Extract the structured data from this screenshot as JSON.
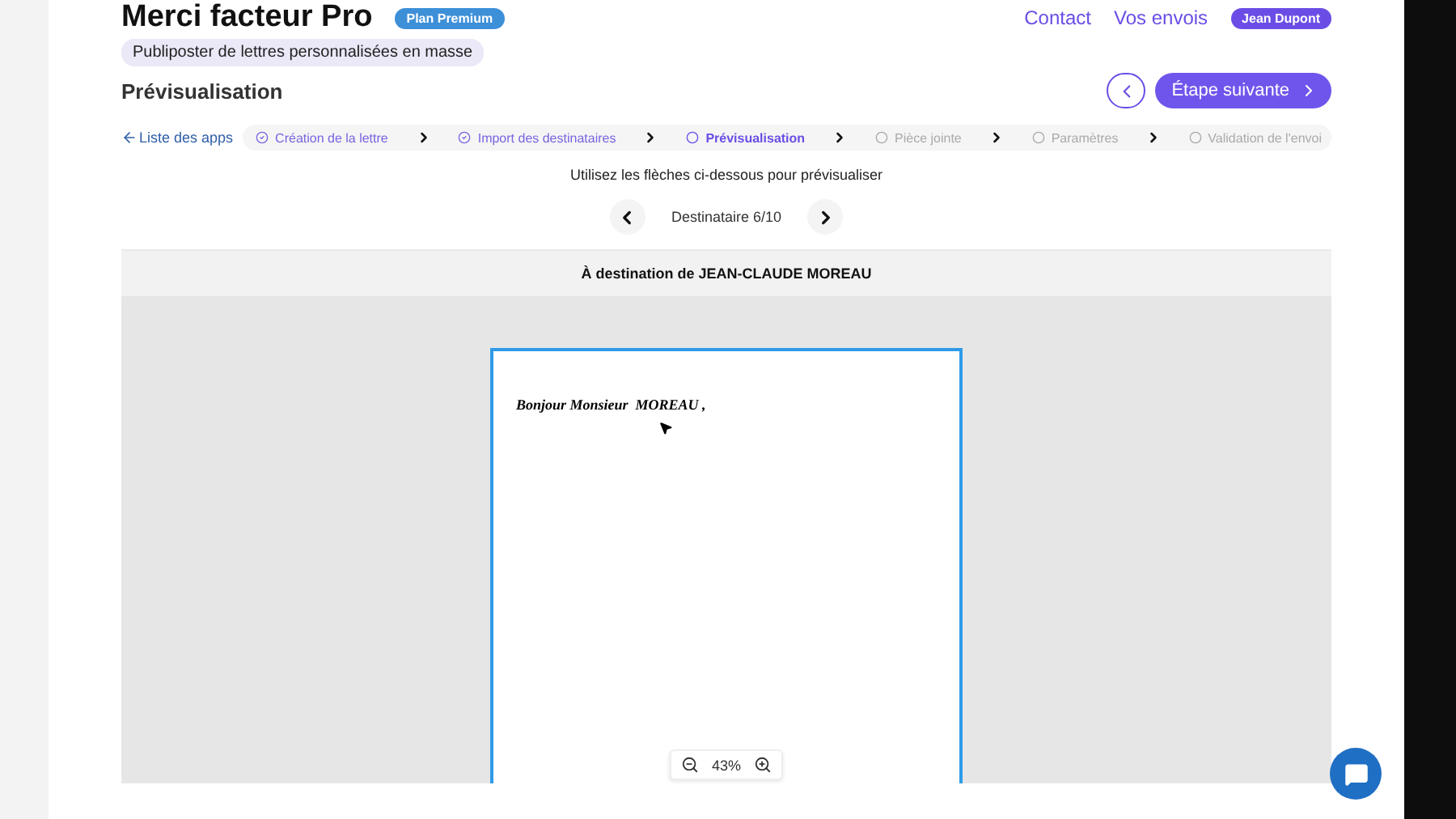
{
  "header": {
    "brand": "Merci facteur Pro",
    "plan_badge": "Plan Premium",
    "nav": [
      "Contact",
      "Vos envois"
    ],
    "user_badge": "Jean Dupont"
  },
  "app_tag": "Publiposter de lettres personnalisées en masse",
  "page_title": "Prévisualisation",
  "next_button": "Étape suivante",
  "back_link": "Liste des apps",
  "steps": [
    {
      "label": "Création de la lettre",
      "completed": true,
      "selected": false
    },
    {
      "label": "Import des destinataires",
      "completed": true,
      "selected": false
    },
    {
      "label": "Prévisualisation",
      "completed": false,
      "selected": true
    },
    {
      "label": "Pièce jointe",
      "completed": false,
      "selected": false
    },
    {
      "label": "Paramètres",
      "completed": false,
      "selected": false
    },
    {
      "label": "Validation de l'envoi",
      "completed": false,
      "selected": false
    }
  ],
  "hint": "Utilisez les flèches ci-dessous pour prévisualiser",
  "recipient_counter": "Destinataire 6/10",
  "preview_header": "À destination de JEAN-CLAUDE MOREAU",
  "letter_text": "Bonjour Monsieur  MOREAU ,",
  "zoom_level": "43%"
}
